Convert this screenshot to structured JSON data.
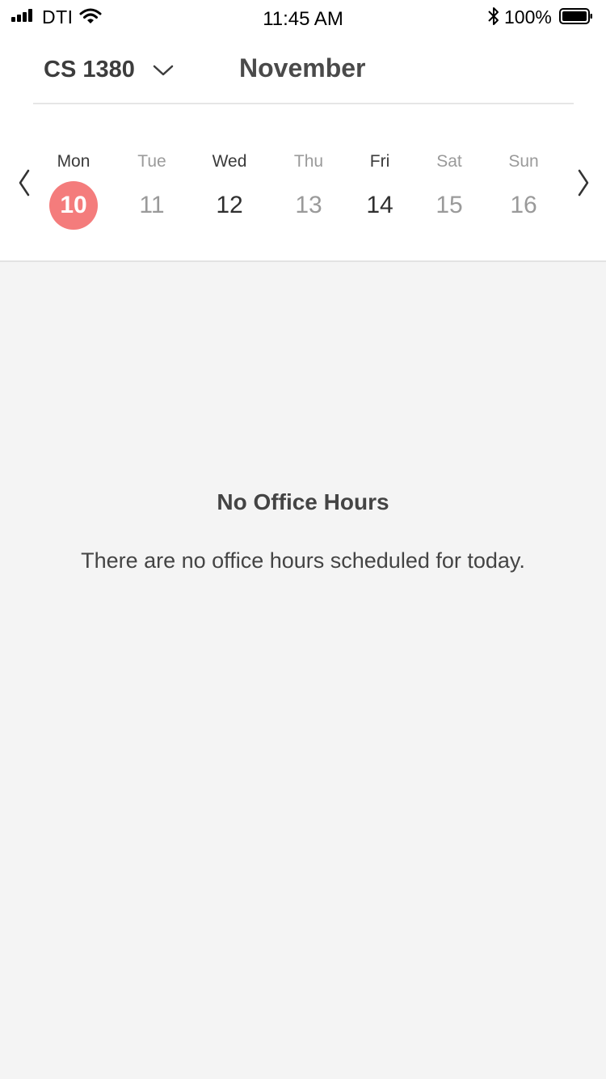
{
  "status_bar": {
    "carrier": "DTI",
    "time": "11:45 AM",
    "battery": "100%",
    "icons": [
      "signal-icon",
      "wifi-icon",
      "bluetooth-icon",
      "battery-icon"
    ]
  },
  "header": {
    "course": "CS 1380",
    "month": "November"
  },
  "week": {
    "days": [
      {
        "name": "Mon",
        "num": "10",
        "state": "selected"
      },
      {
        "name": "Tue",
        "num": "11",
        "state": "muted"
      },
      {
        "name": "Wed",
        "num": "12",
        "state": "dark"
      },
      {
        "name": "Thu",
        "num": "13",
        "state": "muted"
      },
      {
        "name": "Fri",
        "num": "14",
        "state": "dark"
      },
      {
        "name": "Sat",
        "num": "15",
        "state": "muted"
      },
      {
        "name": "Sun",
        "num": "16",
        "state": "muted"
      }
    ]
  },
  "empty_state": {
    "title": "No Office Hours",
    "message": "There are no office hours scheduled for today."
  },
  "colors": {
    "accent": "#f47c7c",
    "background": "#f4f4f4",
    "surface": "#ffffff"
  }
}
